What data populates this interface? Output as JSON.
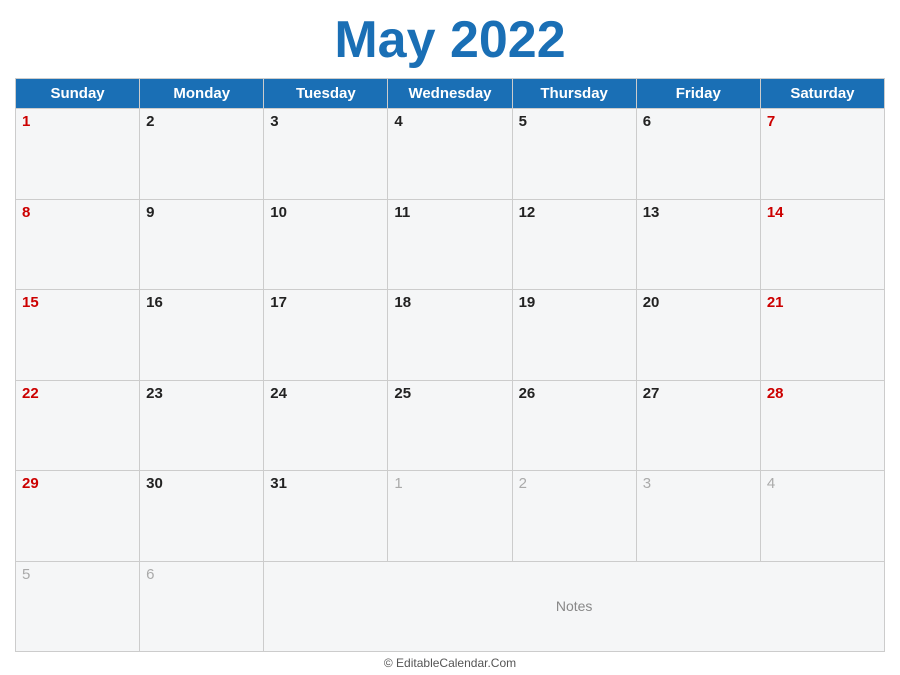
{
  "title": "May 2022",
  "days_of_week": [
    "Sunday",
    "Monday",
    "Tuesday",
    "Wednesday",
    "Thursday",
    "Friday",
    "Saturday"
  ],
  "weeks": [
    [
      {
        "day": "1",
        "type": "sunday"
      },
      {
        "day": "2",
        "type": "weekday"
      },
      {
        "day": "3",
        "type": "weekday"
      },
      {
        "day": "4",
        "type": "weekday"
      },
      {
        "day": "5",
        "type": "weekday"
      },
      {
        "day": "6",
        "type": "weekday"
      },
      {
        "day": "7",
        "type": "saturday"
      }
    ],
    [
      {
        "day": "8",
        "type": "sunday"
      },
      {
        "day": "9",
        "type": "weekday"
      },
      {
        "day": "10",
        "type": "weekday"
      },
      {
        "day": "11",
        "type": "weekday"
      },
      {
        "day": "12",
        "type": "weekday"
      },
      {
        "day": "13",
        "type": "weekday"
      },
      {
        "day": "14",
        "type": "saturday"
      }
    ],
    [
      {
        "day": "15",
        "type": "sunday"
      },
      {
        "day": "16",
        "type": "weekday"
      },
      {
        "day": "17",
        "type": "weekday"
      },
      {
        "day": "18",
        "type": "weekday"
      },
      {
        "day": "19",
        "type": "weekday"
      },
      {
        "day": "20",
        "type": "weekday"
      },
      {
        "day": "21",
        "type": "saturday"
      }
    ],
    [
      {
        "day": "22",
        "type": "sunday"
      },
      {
        "day": "23",
        "type": "weekday"
      },
      {
        "day": "24",
        "type": "weekday"
      },
      {
        "day": "25",
        "type": "weekday"
      },
      {
        "day": "26",
        "type": "weekday"
      },
      {
        "day": "27",
        "type": "weekday"
      },
      {
        "day": "28",
        "type": "saturday"
      }
    ],
    [
      {
        "day": "29",
        "type": "sunday"
      },
      {
        "day": "30",
        "type": "weekday"
      },
      {
        "day": "31",
        "type": "weekday"
      },
      {
        "day": "1",
        "type": "other-month"
      },
      {
        "day": "2",
        "type": "other-month"
      },
      {
        "day": "3",
        "type": "other-month"
      },
      {
        "day": "4",
        "type": "other-month"
      }
    ],
    [
      {
        "day": "5",
        "type": "other-month"
      },
      {
        "day": "6",
        "type": "other-month"
      },
      {
        "day": "Notes",
        "type": "notes",
        "colspan": 5
      }
    ]
  ],
  "footer": "© EditableCalendar.Com",
  "notes_label": "Notes"
}
